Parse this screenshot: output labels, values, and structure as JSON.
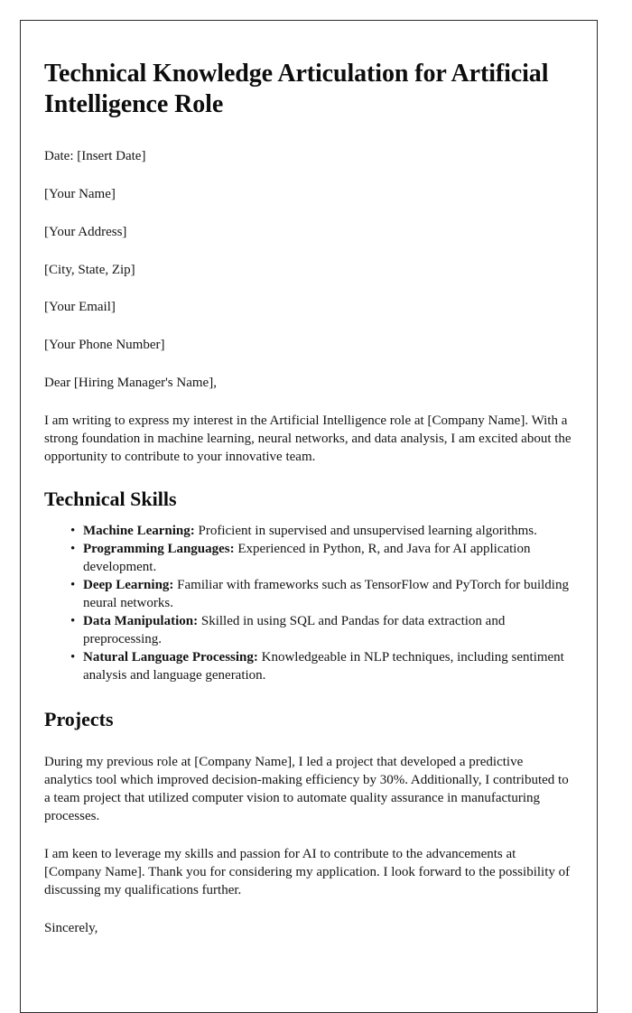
{
  "document": {
    "title": "Technical Knowledge Articulation for Artificial Intelligence Role",
    "date_line": "Date: [Insert Date]",
    "sender": {
      "name": "[Your Name]",
      "address": "[Your Address]",
      "city_state_zip": "[City, State, Zip]",
      "email": "[Your Email]",
      "phone": "[Your Phone Number]"
    },
    "salutation": "Dear [Hiring Manager's Name],",
    "intro_paragraph": "I am writing to express my interest in the Artificial Intelligence role at [Company Name]. With a strong foundation in machine learning, neural networks, and data analysis, I am excited about the opportunity to contribute to your innovative team.",
    "sections": {
      "technical_skills": {
        "heading": "Technical Skills",
        "items": [
          {
            "term": "Machine Learning:",
            "description": " Proficient in supervised and unsupervised learning algorithms."
          },
          {
            "term": "Programming Languages:",
            "description": " Experienced in Python, R, and Java for AI application development."
          },
          {
            "term": "Deep Learning:",
            "description": " Familiar with frameworks such as TensorFlow and PyTorch for building neural networks."
          },
          {
            "term": "Data Manipulation:",
            "description": " Skilled in using SQL and Pandas for data extraction and preprocessing."
          },
          {
            "term": "Natural Language Processing:",
            "description": " Knowledgeable in NLP techniques, including sentiment analysis and language generation."
          }
        ]
      },
      "projects": {
        "heading": "Projects",
        "paragraph": "During my previous role at [Company Name], I led a project that developed a predictive analytics tool which improved decision-making efficiency by 30%. Additionally, I contributed to a team project that utilized computer vision to automate quality assurance in manufacturing processes."
      }
    },
    "closing_paragraph": "I am keen to leverage my skills and passion for AI to contribute to the advancements at [Company Name]. Thank you for considering my application. I look forward to the possibility of discussing my qualifications further.",
    "signoff": "Sincerely,"
  }
}
